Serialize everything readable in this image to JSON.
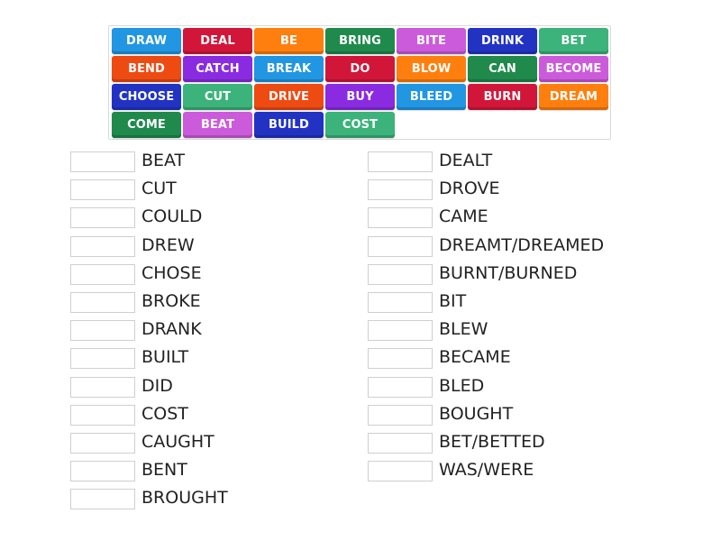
{
  "colors": {
    "blue": "#2196e3",
    "red": "#d2163a",
    "orange": "#ff7f0e",
    "green": "#1f8a4c",
    "pink": "#cc5bdb",
    "navy": "#2233c4",
    "teal": "#3bb37a",
    "redorange": "#ee4b12",
    "purple": "#8a2be2"
  },
  "tiles": [
    {
      "label": "DRAW",
      "color": "blue"
    },
    {
      "label": "DEAL",
      "color": "red"
    },
    {
      "label": "BE",
      "color": "orange"
    },
    {
      "label": "BRING",
      "color": "green"
    },
    {
      "label": "BITE",
      "color": "pink"
    },
    {
      "label": "DRINK",
      "color": "navy"
    },
    {
      "label": "BET",
      "color": "teal"
    },
    {
      "label": "BEND",
      "color": "redorange"
    },
    {
      "label": "CATCH",
      "color": "purple"
    },
    {
      "label": "BREAK",
      "color": "blue"
    },
    {
      "label": "DO",
      "color": "red"
    },
    {
      "label": "BLOW",
      "color": "orange"
    },
    {
      "label": "CAN",
      "color": "green"
    },
    {
      "label": "BECOME",
      "color": "pink"
    },
    {
      "label": "CHOOSE",
      "color": "navy"
    },
    {
      "label": "CUT",
      "color": "teal"
    },
    {
      "label": "DRIVE",
      "color": "redorange"
    },
    {
      "label": "BUY",
      "color": "purple"
    },
    {
      "label": "BLEED",
      "color": "blue"
    },
    {
      "label": "BURN",
      "color": "red"
    },
    {
      "label": "DREAM",
      "color": "orange"
    },
    {
      "label": "COME",
      "color": "green"
    },
    {
      "label": "BEAT",
      "color": "pink"
    },
    {
      "label": "BUILD",
      "color": "navy"
    },
    {
      "label": "COST",
      "color": "teal"
    }
  ],
  "left_answers": [
    "BEAT",
    "CUT",
    "COULD",
    "DREW",
    "CHOSE",
    "BROKE",
    "DRANK",
    "BUILT",
    "DID",
    "COST",
    "CAUGHT",
    "BENT",
    "BROUGHT"
  ],
  "right_answers": [
    "DEALT",
    "DROVE",
    "CAME",
    "DREAMT/DREAMED",
    "BURNT/BURNED",
    "BIT",
    "BLEW",
    "BECAME",
    "BLED",
    "BOUGHT",
    "BET/BETTED",
    "WAS/WERE"
  ]
}
